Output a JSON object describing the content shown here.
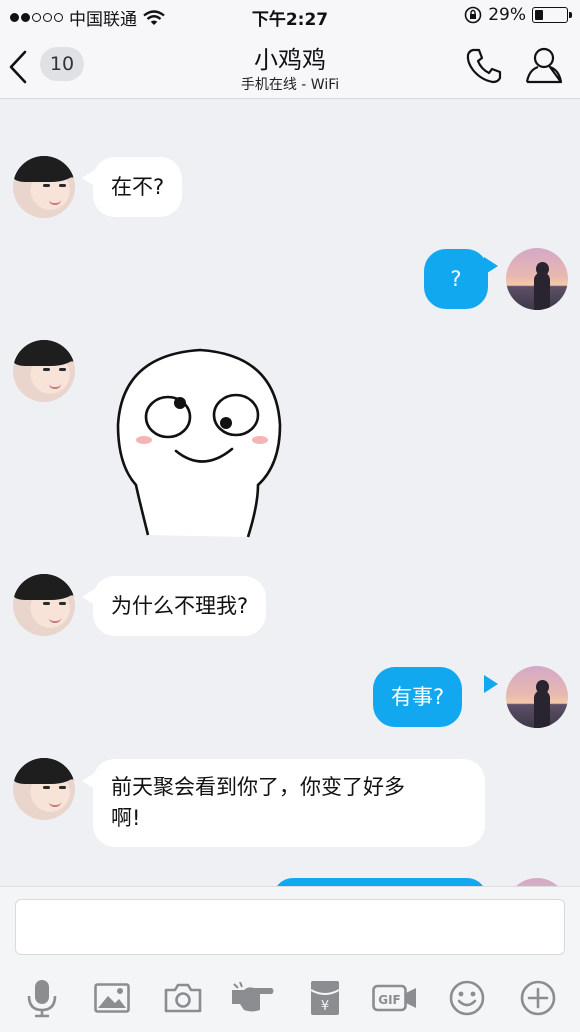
{
  "status_bar": {
    "carrier": "中国联通",
    "time": "下午2:27",
    "battery_percent": "29%",
    "battery_level": 0.29,
    "signal_bars_filled": 2,
    "signal_bars_total": 5,
    "icons": [
      "wifi-icon",
      "rotation-lock-icon",
      "battery-icon"
    ]
  },
  "nav": {
    "back_badge": "10",
    "title": "小鸡鸡",
    "subtitle": "手机在线 - WiFi",
    "icons": [
      "back-chevron-icon",
      "phone-icon",
      "profile-icon"
    ]
  },
  "messages": [
    {
      "sender": "them",
      "text": "在不?"
    },
    {
      "sender": "me",
      "text": "?"
    },
    {
      "sender": "them",
      "type": "sticker",
      "sticker": "sticker-face-icon"
    },
    {
      "sender": "them",
      "text": "为什么不理我?"
    },
    {
      "sender": "me",
      "text": "有事?"
    },
    {
      "sender": "them",
      "text_line1": "前天聚会看到你了，你变了好多",
      "text_line2": "啊!"
    }
  ],
  "composer": {
    "value": "",
    "placeholder": ""
  },
  "toolbar": [
    "microphone-icon",
    "image-icon",
    "camera-icon",
    "poke-icon",
    "red-packet-icon",
    "gif-icon",
    "emoji-icon",
    "plus-icon"
  ],
  "colors": {
    "outgoing_bubble": "#12a8f0",
    "incoming_bubble": "#ffffff",
    "background": "#eef0f3"
  }
}
